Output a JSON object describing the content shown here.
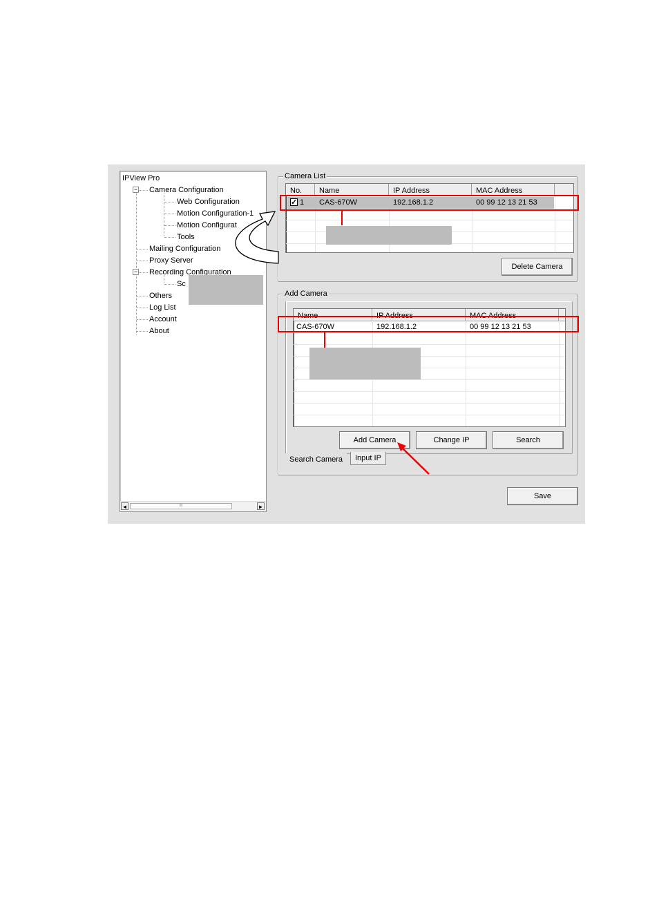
{
  "tree": {
    "root": "IPView Pro",
    "items": [
      {
        "label": "Camera Configuration"
      },
      {
        "label": "Web Configuration"
      },
      {
        "label": "Motion Configuration-1"
      },
      {
        "label": "Motion Configurat"
      },
      {
        "label": "Tools"
      },
      {
        "label": "Mailing Configuration"
      },
      {
        "label": "Proxy Server"
      },
      {
        "label": "Recording Configuration"
      },
      {
        "label": "Sc"
      },
      {
        "label": "Others"
      },
      {
        "label": "Log List"
      },
      {
        "label": "Account"
      },
      {
        "label": "About"
      }
    ],
    "expander_symbol": "−",
    "scroll_left": "◄",
    "scroll_right": "►",
    "scroll_thumb": "III"
  },
  "camera_list": {
    "group_label": "Camera List",
    "columns": [
      "No.",
      "Name",
      "IP Address",
      "MAC Address"
    ],
    "rows": [
      {
        "checked": "✓",
        "no": "1",
        "name": "CAS-670W",
        "ip": "192.168.1.2",
        "mac": "00 99 12 13 21 53"
      }
    ],
    "delete_label": "Delete Camera"
  },
  "add_camera": {
    "group_label": "Add Camera",
    "columns": [
      "Name",
      "IP Address",
      "MAC Address"
    ],
    "rows": [
      {
        "name": "CAS-670W",
        "ip": "192.168.1.2",
        "mac": "00 99 12 13 21 53"
      }
    ],
    "buttons": {
      "add": "Add Camera",
      "change_ip": "Change IP",
      "search": "Search"
    },
    "tabs": [
      "Search Camera",
      "Input IP"
    ]
  },
  "save_label": "Save",
  "colors": {
    "annotation_red": "#ee0000",
    "selection": "#c0c0c0",
    "window": "#e1e1e1"
  }
}
